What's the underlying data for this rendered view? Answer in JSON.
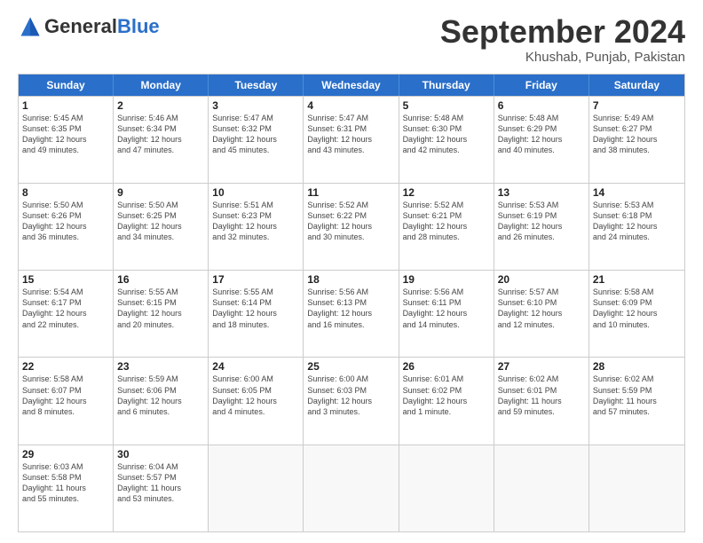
{
  "header": {
    "logo_general": "General",
    "logo_blue": "Blue",
    "month_title": "September 2024",
    "location": "Khushab, Punjab, Pakistan"
  },
  "weekdays": [
    "Sunday",
    "Monday",
    "Tuesday",
    "Wednesday",
    "Thursday",
    "Friday",
    "Saturday"
  ],
  "rows": [
    [
      {
        "day": "1",
        "info": "Sunrise: 5:45 AM\nSunset: 6:35 PM\nDaylight: 12 hours\nand 49 minutes."
      },
      {
        "day": "2",
        "info": "Sunrise: 5:46 AM\nSunset: 6:34 PM\nDaylight: 12 hours\nand 47 minutes."
      },
      {
        "day": "3",
        "info": "Sunrise: 5:47 AM\nSunset: 6:32 PM\nDaylight: 12 hours\nand 45 minutes."
      },
      {
        "day": "4",
        "info": "Sunrise: 5:47 AM\nSunset: 6:31 PM\nDaylight: 12 hours\nand 43 minutes."
      },
      {
        "day": "5",
        "info": "Sunrise: 5:48 AM\nSunset: 6:30 PM\nDaylight: 12 hours\nand 42 minutes."
      },
      {
        "day": "6",
        "info": "Sunrise: 5:48 AM\nSunset: 6:29 PM\nDaylight: 12 hours\nand 40 minutes."
      },
      {
        "day": "7",
        "info": "Sunrise: 5:49 AM\nSunset: 6:27 PM\nDaylight: 12 hours\nand 38 minutes."
      }
    ],
    [
      {
        "day": "8",
        "info": "Sunrise: 5:50 AM\nSunset: 6:26 PM\nDaylight: 12 hours\nand 36 minutes."
      },
      {
        "day": "9",
        "info": "Sunrise: 5:50 AM\nSunset: 6:25 PM\nDaylight: 12 hours\nand 34 minutes."
      },
      {
        "day": "10",
        "info": "Sunrise: 5:51 AM\nSunset: 6:23 PM\nDaylight: 12 hours\nand 32 minutes."
      },
      {
        "day": "11",
        "info": "Sunrise: 5:52 AM\nSunset: 6:22 PM\nDaylight: 12 hours\nand 30 minutes."
      },
      {
        "day": "12",
        "info": "Sunrise: 5:52 AM\nSunset: 6:21 PM\nDaylight: 12 hours\nand 28 minutes."
      },
      {
        "day": "13",
        "info": "Sunrise: 5:53 AM\nSunset: 6:19 PM\nDaylight: 12 hours\nand 26 minutes."
      },
      {
        "day": "14",
        "info": "Sunrise: 5:53 AM\nSunset: 6:18 PM\nDaylight: 12 hours\nand 24 minutes."
      }
    ],
    [
      {
        "day": "15",
        "info": "Sunrise: 5:54 AM\nSunset: 6:17 PM\nDaylight: 12 hours\nand 22 minutes."
      },
      {
        "day": "16",
        "info": "Sunrise: 5:55 AM\nSunset: 6:15 PM\nDaylight: 12 hours\nand 20 minutes."
      },
      {
        "day": "17",
        "info": "Sunrise: 5:55 AM\nSunset: 6:14 PM\nDaylight: 12 hours\nand 18 minutes."
      },
      {
        "day": "18",
        "info": "Sunrise: 5:56 AM\nSunset: 6:13 PM\nDaylight: 12 hours\nand 16 minutes."
      },
      {
        "day": "19",
        "info": "Sunrise: 5:56 AM\nSunset: 6:11 PM\nDaylight: 12 hours\nand 14 minutes."
      },
      {
        "day": "20",
        "info": "Sunrise: 5:57 AM\nSunset: 6:10 PM\nDaylight: 12 hours\nand 12 minutes."
      },
      {
        "day": "21",
        "info": "Sunrise: 5:58 AM\nSunset: 6:09 PM\nDaylight: 12 hours\nand 10 minutes."
      }
    ],
    [
      {
        "day": "22",
        "info": "Sunrise: 5:58 AM\nSunset: 6:07 PM\nDaylight: 12 hours\nand 8 minutes."
      },
      {
        "day": "23",
        "info": "Sunrise: 5:59 AM\nSunset: 6:06 PM\nDaylight: 12 hours\nand 6 minutes."
      },
      {
        "day": "24",
        "info": "Sunrise: 6:00 AM\nSunset: 6:05 PM\nDaylight: 12 hours\nand 4 minutes."
      },
      {
        "day": "25",
        "info": "Sunrise: 6:00 AM\nSunset: 6:03 PM\nDaylight: 12 hours\nand 3 minutes."
      },
      {
        "day": "26",
        "info": "Sunrise: 6:01 AM\nSunset: 6:02 PM\nDaylight: 12 hours\nand 1 minute."
      },
      {
        "day": "27",
        "info": "Sunrise: 6:02 AM\nSunset: 6:01 PM\nDaylight: 11 hours\nand 59 minutes."
      },
      {
        "day": "28",
        "info": "Sunrise: 6:02 AM\nSunset: 5:59 PM\nDaylight: 11 hours\nand 57 minutes."
      }
    ],
    [
      {
        "day": "29",
        "info": "Sunrise: 6:03 AM\nSunset: 5:58 PM\nDaylight: 11 hours\nand 55 minutes."
      },
      {
        "day": "30",
        "info": "Sunrise: 6:04 AM\nSunset: 5:57 PM\nDaylight: 11 hours\nand 53 minutes."
      },
      {
        "day": "",
        "info": ""
      },
      {
        "day": "",
        "info": ""
      },
      {
        "day": "",
        "info": ""
      },
      {
        "day": "",
        "info": ""
      },
      {
        "day": "",
        "info": ""
      }
    ]
  ]
}
